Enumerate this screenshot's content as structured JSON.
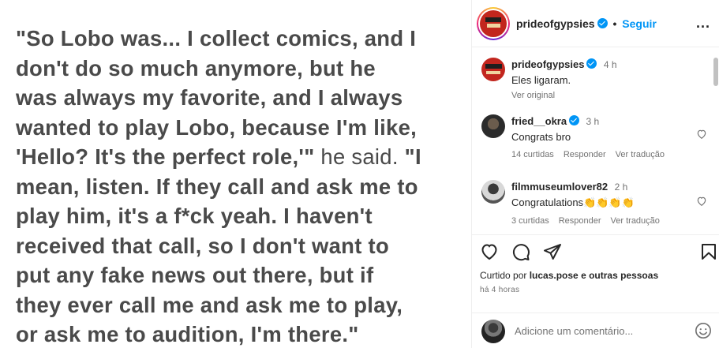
{
  "post": {
    "quote_bold_1": "\"So Lobo was... I collect comics, and I\ndon't do so much anymore, but he\nwas always my favorite, and I always\nwanted to play Lobo, because I'm like,\n'Hello? It's the perfect role,'\"",
    "quote_plain": " he said. ",
    "quote_bold_2": "\"I\nmean, listen. If they call and ask me to\nplay him, it's a f*ck yeah. I haven't\nreceived that call, so I don't want to\nput any fake news out there, but if\nthey ever call me and ask me to play,\nor ask me to audition, I'm there.\""
  },
  "header": {
    "username": "prideofgypsies",
    "separator": "•",
    "follow_label": "Seguir",
    "more_label": "..."
  },
  "comments": [
    {
      "username": "prideofgypsies",
      "time": "4 h",
      "text": "Eles ligaram.",
      "meta": [
        "Ver original"
      ],
      "verified": true
    },
    {
      "username": "fried__okra",
      "time": "3 h",
      "text": "Congrats bro",
      "meta": [
        "14 curtidas",
        "Responder",
        "Ver tradução"
      ],
      "verified": true
    },
    {
      "username": "filmmuseumlover82",
      "time": "2 h",
      "text": "Congratulations👏👏👏👏",
      "meta": [
        "3 curtidas",
        "Responder",
        "Ver tradução"
      ],
      "verified": false
    }
  ],
  "actions": {
    "liked_prefix": "Curtido por ",
    "liked_user": "lucas.pose",
    "liked_suffix": " e outras pessoas",
    "time_ago": "há 4 horas"
  },
  "add_comment": {
    "placeholder": "Adicione um comentário..."
  },
  "colors": {
    "accent": "#0095f6",
    "text": "#262626",
    "muted": "#737373",
    "quote": "#4a4a4a"
  },
  "icons": [
    "verified-badge-icon",
    "more-options-icon",
    "heart-icon",
    "comment-icon",
    "share-icon",
    "bookmark-icon",
    "emoji-icon"
  ]
}
